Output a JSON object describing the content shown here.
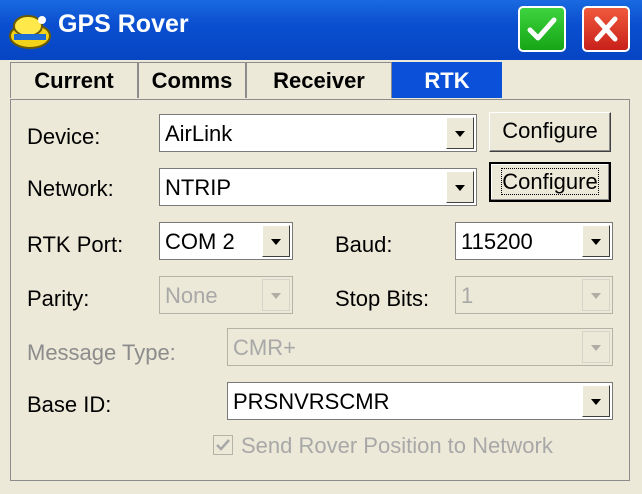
{
  "window": {
    "title": "GPS Rover"
  },
  "tabs": [
    {
      "label": "Current"
    },
    {
      "label": "Comms"
    },
    {
      "label": "Receiver"
    },
    {
      "label": "RTK"
    }
  ],
  "form": {
    "device": {
      "label": "Device:",
      "value": "AirLink",
      "button": "Configure"
    },
    "network": {
      "label": "Network:",
      "value": "NTRIP",
      "button": "Configure"
    },
    "rtk_port": {
      "label": "RTK Port:",
      "value": "COM 2"
    },
    "baud": {
      "label": "Baud:",
      "value": "115200"
    },
    "parity": {
      "label": "Parity:",
      "value": "None"
    },
    "stop_bits": {
      "label": "Stop Bits:",
      "value": "1"
    },
    "message_type": {
      "label": "Message Type:",
      "value": "CMR+"
    },
    "base_id": {
      "label": "Base ID:",
      "value": "PRSNVRSCMR"
    },
    "send_rover": {
      "label": "Send Rover Position to Network",
      "checked": true,
      "enabled": false
    }
  },
  "colors": {
    "titlebar": "#0a4fd0",
    "active_tab": "#0a50d8",
    "ok": "#16a516",
    "close": "#c8201a"
  },
  "icons": {
    "app": "rover-icon",
    "ok": "checkmark-icon",
    "close": "close-icon"
  }
}
